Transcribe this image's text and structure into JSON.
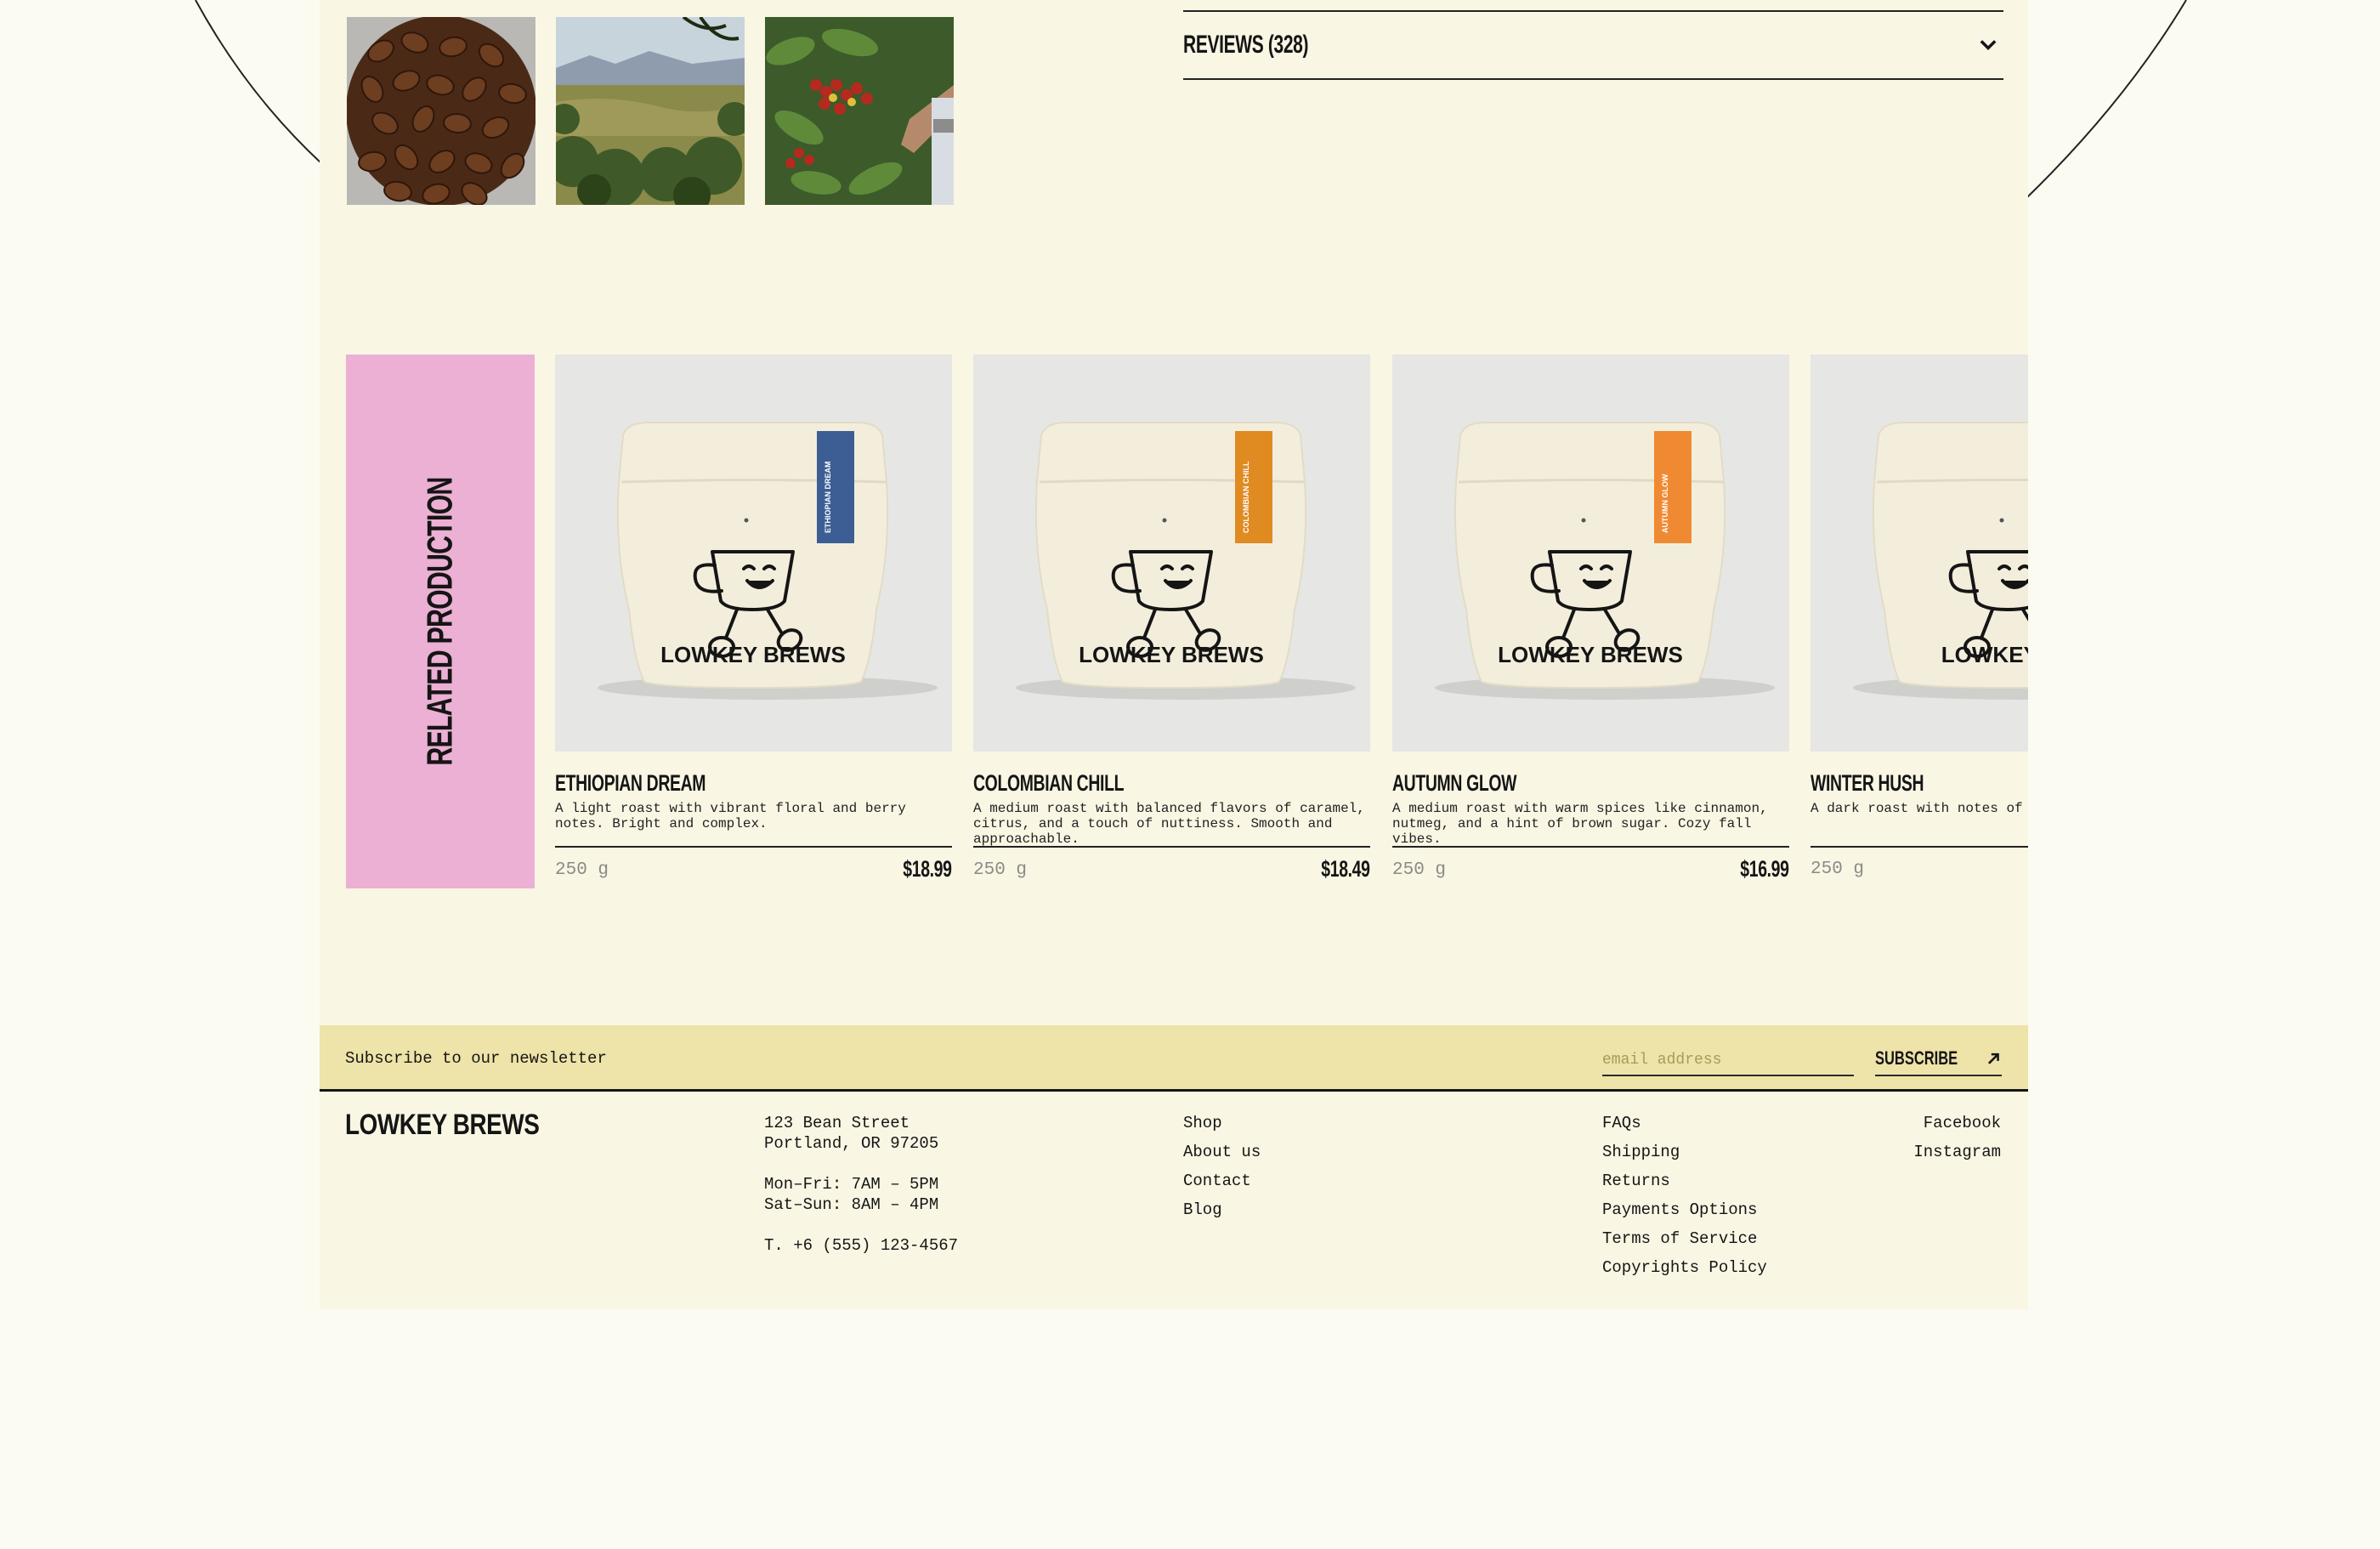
{
  "reviews": {
    "label": "REVIEWS (328)"
  },
  "gallery": [
    {
      "alt": "Roasted coffee beans"
    },
    {
      "alt": "Coffee farm landscape"
    },
    {
      "alt": "Picking coffee cherries"
    }
  ],
  "related": {
    "heading": "RELATED PRODUCTION",
    "products": [
      {
        "name": "ETHIOPIAN DREAM",
        "description": "A light roast with vibrant floral and berry notes. Bright and complex.",
        "weight": "250 g",
        "price": "$18.99",
        "label_color": "#3d5e94",
        "label_text": "ETHIOPIAN DREAM",
        "bag_brand": "LOWKEY BREWS"
      },
      {
        "name": "COLOMBIAN CHILL",
        "description": "A medium roast with balanced flavors of caramel, citrus, and a touch of nuttiness. Smooth and approachable.",
        "weight": "250 g",
        "price": "$18.49",
        "label_color": "#e08a22",
        "label_text": "COLOMBIAN CHILL",
        "bag_brand": "LOWKEY BREWS"
      },
      {
        "name": "AUTUMN GLOW",
        "description": "A medium roast with warm spices like cinnamon, nutmeg, and a hint of brown sugar. Cozy fall vibes.",
        "weight": "250 g",
        "price": "$16.99",
        "label_color": "#f08a32",
        "label_text": "AUTUMN GLOW",
        "bag_brand": "LOWKEY BREWS"
      },
      {
        "name": "WINTER HUSH",
        "description": "A dark roast with notes of pe cocoa. Perfect for sipping by",
        "weight": "250 g",
        "price": "",
        "label_color": "#2b2b2b",
        "label_text": "",
        "bag_brand": "LOWKEY BR"
      }
    ]
  },
  "newsletter": {
    "label": "Subscribe to our newsletter",
    "email_placeholder": "email address",
    "email_value": "",
    "subscribe_label": "SUBSCRIBE"
  },
  "footer": {
    "logo": "LOWKEY BREWS",
    "address_line1": "123 Bean Street",
    "address_line2": "Portland, OR 97205",
    "hours_weekday": "Mon–Fri: 7AM – 5PM",
    "hours_weekend": "Sat–Sun: 8AM – 4PM",
    "phone": "T. +6 (555) 123-4567",
    "nav": [
      "Shop",
      "About us",
      "Contact",
      "Blog"
    ],
    "help": [
      "FAQs",
      "Shipping",
      "Returns",
      "Payments Options",
      "Terms of Service",
      "Copyrights Policy"
    ],
    "social": [
      "Facebook",
      "Instagram"
    ]
  },
  "colors": {
    "page_bg": "#faf6e4",
    "outer_bg": "#fcfbf1",
    "related_banner": "#ebb0d4",
    "newsletter_bg": "#eee3a8",
    "product_image_bg": "#e6e6e4",
    "text": "#151515"
  }
}
